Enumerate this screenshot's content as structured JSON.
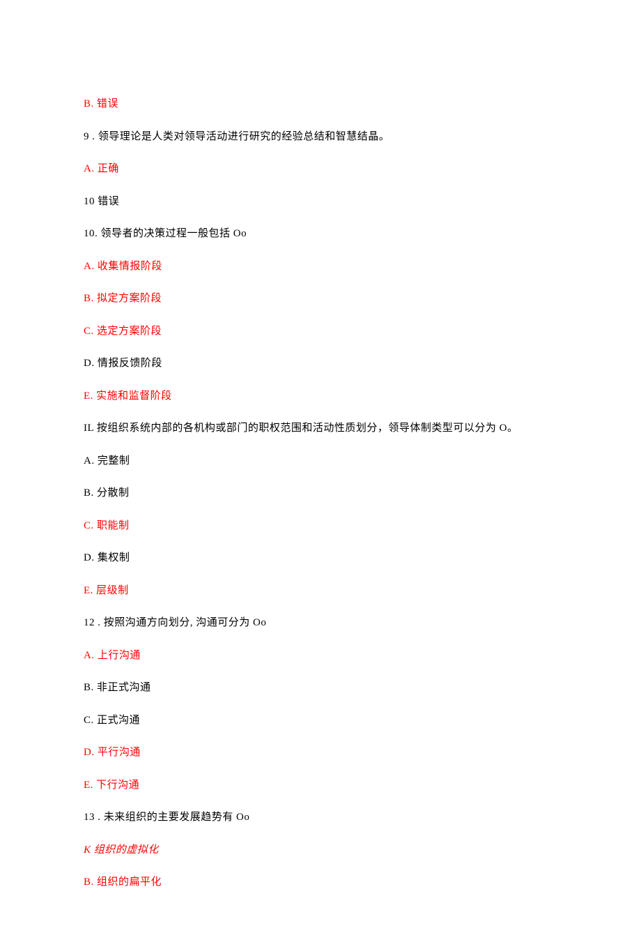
{
  "lines": [
    {
      "text": "B. 错误",
      "red": true
    },
    {
      "text": "9    . 领导理论是人类对领导活动进行研究的经验总结和智慧结晶。",
      "red": false
    },
    {
      "text": "A. 正确",
      "red": true
    },
    {
      "text": "10   错误",
      "red": false
    },
    {
      "text": "10. 领导者的决策过程一般包括 Oo",
      "red": false
    },
    {
      "text": "A. 收集情报阶段",
      "red": true
    },
    {
      "text": "B. 拟定方案阶段",
      "red": true
    },
    {
      "text": "C. 选定方案阶段",
      "red": true
    },
    {
      "text": "D. 情报反馈阶段",
      "red": false
    },
    {
      "text": "E. 实施和监督阶段",
      "red": true
    },
    {
      "text": "IL 按组织系统内部的各机构或部门的职权范围和活动性质划分，领导体制类型可以分为 O。",
      "red": false
    },
    {
      "text": "A. 完整制",
      "red": false
    },
    {
      "text": "B. 分散制",
      "red": false
    },
    {
      "text": "C. 职能制",
      "red": true
    },
    {
      "text": "D. 集权制",
      "red": false
    },
    {
      "text": "E. 层级制",
      "red": true
    },
    {
      "text": "12    . 按照沟通方向划分, 沟通可分为 Oo",
      "red": false
    },
    {
      "text": "A. 上行沟通",
      "red": true
    },
    {
      "text": "B. 非正式沟通",
      "red": false
    },
    {
      "text": "C. 正式沟通",
      "red": false
    },
    {
      "text": "D. 平行沟通",
      "red": true
    },
    {
      "text": "E. 下行沟通",
      "red": true
    },
    {
      "text": "13    . 未来组织的主要发展趋势有 Oo",
      "red": false
    },
    {
      "text": "K 组织的虚拟化",
      "red": true,
      "italic": true
    },
    {
      "text": "B. 组织的扁平化",
      "red": true
    }
  ]
}
